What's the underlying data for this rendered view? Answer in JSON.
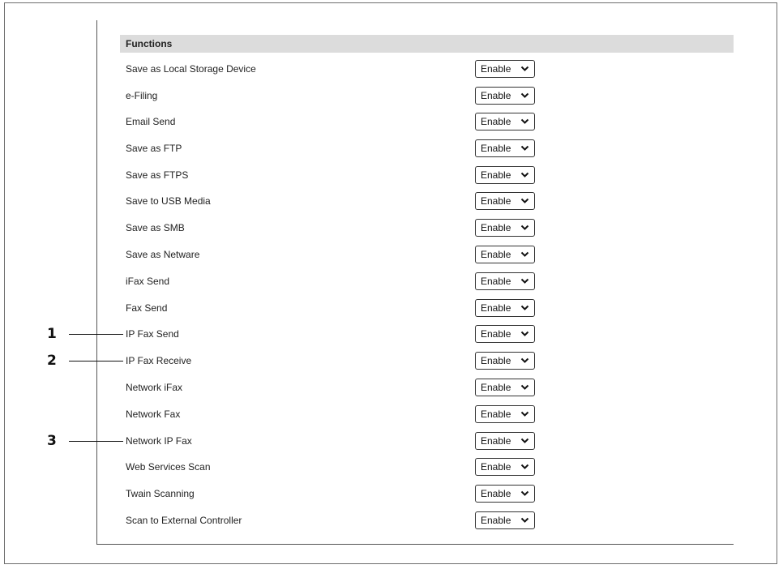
{
  "section": {
    "title": "Functions"
  },
  "rows": [
    {
      "label": "Save as Local Storage Device",
      "value": "Enable"
    },
    {
      "label": "e-Filing",
      "value": "Enable"
    },
    {
      "label": "Email Send",
      "value": "Enable"
    },
    {
      "label": "Save as FTP",
      "value": "Enable"
    },
    {
      "label": "Save as FTPS",
      "value": "Enable"
    },
    {
      "label": "Save to USB Media",
      "value": "Enable"
    },
    {
      "label": "Save as SMB",
      "value": "Enable"
    },
    {
      "label": "Save as Netware",
      "value": "Enable"
    },
    {
      "label": "iFax Send",
      "value": "Enable"
    },
    {
      "label": "Fax Send",
      "value": "Enable"
    },
    {
      "label": "IP Fax Send",
      "value": "Enable"
    },
    {
      "label": "IP Fax Receive",
      "value": "Enable"
    },
    {
      "label": "Network iFax",
      "value": "Enable"
    },
    {
      "label": "Network Fax",
      "value": "Enable"
    },
    {
      "label": "Network IP Fax",
      "value": "Enable"
    },
    {
      "label": "Web Services Scan",
      "value": "Enable"
    },
    {
      "label": "Twain Scanning",
      "value": "Enable"
    },
    {
      "label": "Scan to External Controller",
      "value": "Enable"
    }
  ],
  "callouts": [
    {
      "number": "1"
    },
    {
      "number": "2"
    },
    {
      "number": "3"
    }
  ],
  "icons": {
    "dropdown": "chevron-down-icon"
  }
}
